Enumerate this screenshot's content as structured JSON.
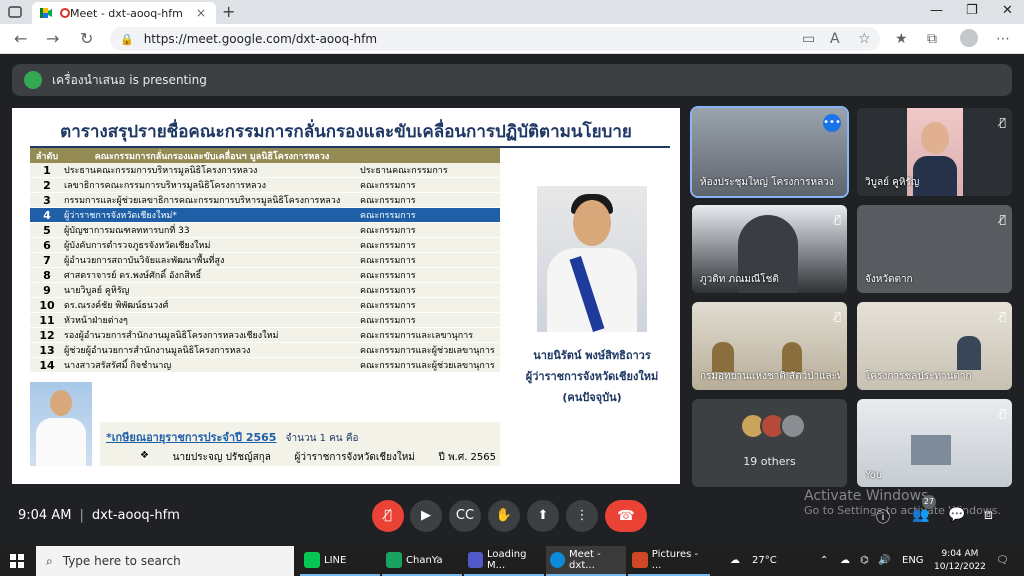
{
  "browser": {
    "tab_title": "Meet - dxt-aooq-hfm",
    "url": "https://meet.google.com/dxt-aooq-hfm",
    "new_tab": "+",
    "close_tab": "×"
  },
  "meet": {
    "presenting_text": "เครื่องนำเสนอ is presenting",
    "time": "9:04 AM",
    "meeting_code": "dxt-aooq-hfm",
    "people_count": "27"
  },
  "slide": {
    "title": "ตารางสรุปรายชื่อคณะกรรมการกลั่นกรองและขับเคลื่อนการปฏิบัติตามนโยบาย",
    "col_order": "ลำดับ",
    "col_committee": "คณะกรรมการกลั่นกรองและขับเคลื่อนฯ มูลนิธิโครงการหลวง",
    "rows": [
      {
        "no": "1",
        "name": "ประธานคณะกรรมการบริหารมูลนิธิโครงการหลวง",
        "role": "ประธานคณะกรรมการ"
      },
      {
        "no": "2",
        "name": "เลขาธิการคณะกรรมการบริหารมูลนิธิโครงการหลวง",
        "role": "คณะกรรมการ"
      },
      {
        "no": "3",
        "name": "กรรมการและผู้ช่วยเลขาธิการคณะกรรมการบริหารมูลนิธิโครงการหลวง",
        "role": "คณะกรรมการ"
      },
      {
        "no": "4",
        "name": "ผู้ว่าราชการจังหวัดเชียงใหม่*",
        "role": "คณะกรรมการ"
      },
      {
        "no": "5",
        "name": "ผู้บัญชาการมณฑลทหารบกที่ 33",
        "role": "คณะกรรมการ"
      },
      {
        "no": "6",
        "name": "ผู้บังคับการตำรวจภูธรจังหวัดเชียงใหม่",
        "role": "คณะกรรมการ"
      },
      {
        "no": "7",
        "name": "ผู้อำนวยการสถาบันวิจัยและพัฒนาพื้นที่สูง",
        "role": "คณะกรรมการ"
      },
      {
        "no": "8",
        "name": "ศาสตราจารย์ ดร.พงษ์ศักดิ์ อังกสิทธิ์",
        "role": "คณะกรรมการ"
      },
      {
        "no": "9",
        "name": "นายวิบูลย์ คูหิรัญ",
        "role": "คณะกรรมการ"
      },
      {
        "no": "10",
        "name": "ดร.ณรงค์ชัย พิพัฒน์ธนวงศ์",
        "role": "คณะกรรมการ"
      },
      {
        "no": "11",
        "name": "หัวหน้าฝ่ายต่างๆ",
        "role": "คณะกรรมการ"
      },
      {
        "no": "12",
        "name": "รองผู้อำนวยการสำนักงานมูลนิธิโครงการหลวงเชียงใหม่",
        "role": "คณะกรรมการและเลขานุการ"
      },
      {
        "no": "13",
        "name": "ผู้ช่วยผู้อำนวยการสำนักงานมูลนิธิโครงการหลวง",
        "role": "คณะกรรมการและผู้ช่วยเลขานุการ"
      },
      {
        "no": "14",
        "name": "นางสาวสรัสรัศมิ์ กิจชำนาญ",
        "role": "คณะกรรมการและผู้ช่วยเลขานุการ"
      }
    ],
    "selected_row": 3,
    "caption_name": "นายนิรัตน์ พงษ์สิทธิถาวร",
    "caption_title": "ผู้ว่าราชการจังหวัดเชียงใหม่",
    "caption_note": "(คนปัจจุบัน)",
    "retire_heading": "*เกษียณอายุราชการประจำปี 2565",
    "retire_count": "จำนวน 1 คน คือ",
    "retire_bullet": "❖",
    "retire_name": "นายประจญ ปรัชญ์สกุล",
    "retire_position": "ผู้ว่าราชการจังหวัดเชียงใหม่",
    "retire_year": "ปี พ.ศ. 2565"
  },
  "tiles": [
    {
      "name": "ห้องประชุมใหญ่ โครงการหลวง",
      "muted": false,
      "bg": "#7a7f86"
    },
    {
      "name": "วิบูลย์ คูหิรัญ",
      "muted": true,
      "bg": "#2c2f33"
    },
    {
      "name": "ภูวดิท ภณมณีโชติ",
      "muted": true,
      "bg": "#4a4d52"
    },
    {
      "name": "จังหวัดตาก",
      "muted": true,
      "bg": "#585b5f"
    },
    {
      "name": "กรมอุทยานแห่งชาติ สัตว์ป่าและพันธุ์พืช",
      "muted": true,
      "bg": "#c8c0b0"
    },
    {
      "name": "โครงการชลประทานตาก",
      "muted": true,
      "bg": "#d9d4c8"
    },
    {
      "name": "You",
      "muted": true,
      "bg": "#e5e7ea"
    }
  ],
  "others_label": "19 others",
  "watermark": {
    "line1": "Activate Windows",
    "line2": "Go to Settings to activate Windows."
  },
  "taskbar": {
    "search_placeholder": "Type here to search",
    "apps": [
      "LINE",
      "ChanYa",
      "Loading M...",
      "Meet - dxt...",
      "Pictures - ..."
    ],
    "temperature": "27°C",
    "lang": "ENG",
    "clock_time": "9:04 AM",
    "clock_date": "10/12/2022"
  },
  "colors": {
    "accent": "#1a73e8",
    "hangup": "#ea4335",
    "table_header": "#948a54",
    "highlight_row": "#1e5fa8"
  }
}
